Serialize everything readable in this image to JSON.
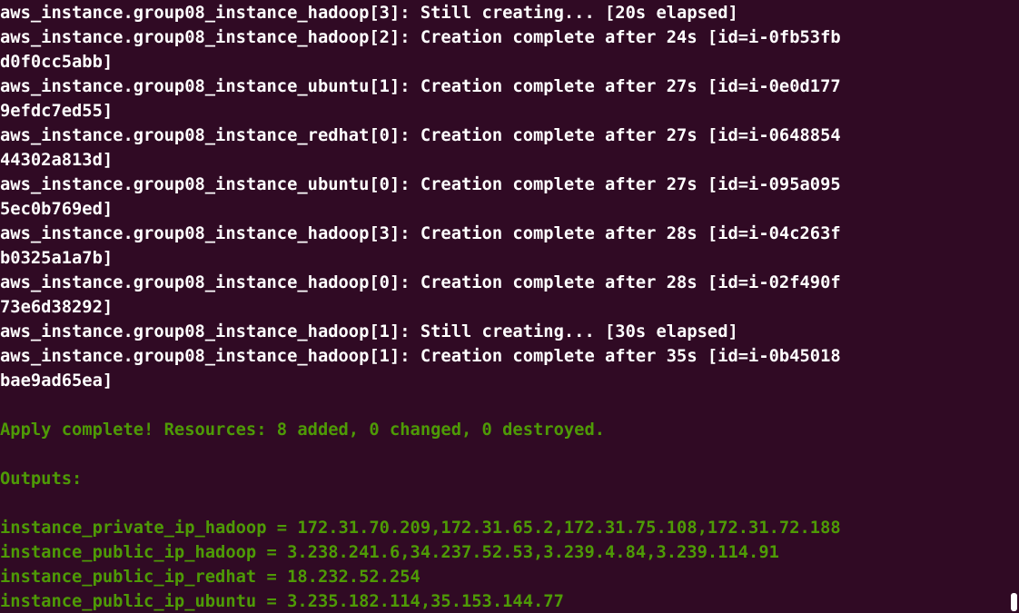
{
  "terminal": {
    "lines": [
      {
        "text": "aws_instance.group08_instance_hadoop[3]: Still creating... [20s elapsed]",
        "color": "#ffffff"
      },
      {
        "text": "aws_instance.group08_instance_hadoop[2]: Creation complete after 24s [id=i-0fb53fb",
        "color": "#ffffff"
      },
      {
        "text": "d0f0cc5abb]",
        "color": "#ffffff"
      },
      {
        "text": "aws_instance.group08_instance_ubuntu[1]: Creation complete after 27s [id=i-0e0d177",
        "color": "#ffffff"
      },
      {
        "text": "9efdc7ed55]",
        "color": "#ffffff"
      },
      {
        "text": "aws_instance.group08_instance_redhat[0]: Creation complete after 27s [id=i-0648854",
        "color": "#ffffff"
      },
      {
        "text": "44302a813d]",
        "color": "#ffffff"
      },
      {
        "text": "aws_instance.group08_instance_ubuntu[0]: Creation complete after 27s [id=i-095a095",
        "color": "#ffffff"
      },
      {
        "text": "5ec0b769ed]",
        "color": "#ffffff"
      },
      {
        "text": "aws_instance.group08_instance_hadoop[3]: Creation complete after 28s [id=i-04c263f",
        "color": "#ffffff"
      },
      {
        "text": "b0325a1a7b]",
        "color": "#ffffff"
      },
      {
        "text": "aws_instance.group08_instance_hadoop[0]: Creation complete after 28s [id=i-02f490f",
        "color": "#ffffff"
      },
      {
        "text": "73e6d38292]",
        "color": "#ffffff"
      },
      {
        "text": "aws_instance.group08_instance_hadoop[1]: Still creating... [30s elapsed]",
        "color": "#ffffff"
      },
      {
        "text": "aws_instance.group08_instance_hadoop[1]: Creation complete after 35s [id=i-0b45018",
        "color": "#ffffff"
      },
      {
        "text": "bae9ad65ea]",
        "color": "#ffffff"
      },
      {
        "text": "",
        "color": "#ffffff"
      },
      {
        "text": "Apply complete! Resources: 8 added, 0 changed, 0 destroyed.",
        "color": "#4e9a06"
      },
      {
        "text": "",
        "color": "#4e9a06"
      },
      {
        "text": "Outputs:",
        "color": "#4e9a06"
      },
      {
        "text": "",
        "color": "#4e9a06"
      },
      {
        "text": "instance_private_ip_hadoop = 172.31.70.209,172.31.65.2,172.31.75.108,172.31.72.188",
        "color": "#4e9a06"
      },
      {
        "text": "instance_public_ip_hadoop = 3.238.241.6,34.237.52.53,3.239.4.84,3.239.114.91",
        "color": "#4e9a06"
      },
      {
        "text": "instance_public_ip_redhat = 18.232.52.254",
        "color": "#4e9a06"
      },
      {
        "text": "instance_public_ip_ubuntu = 3.235.182.114,35.153.144.77",
        "color": "#4e9a06"
      }
    ],
    "background_color": "#300a24",
    "cursor_color": "#ffffff"
  }
}
